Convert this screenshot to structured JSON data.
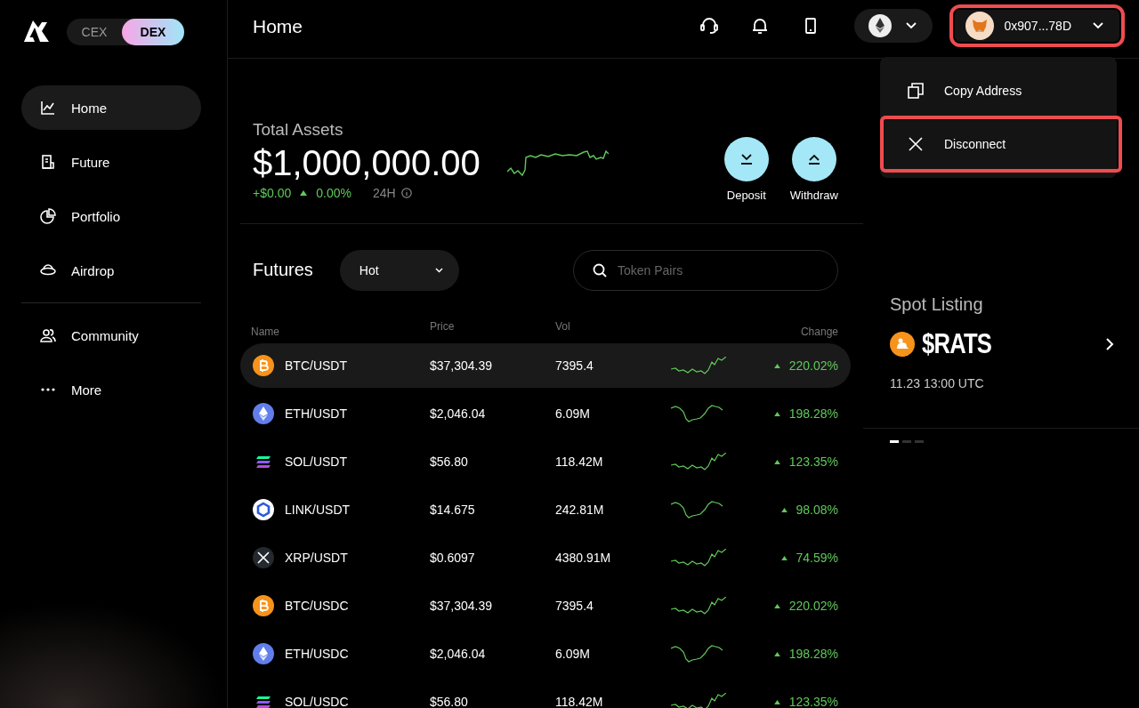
{
  "sidebar": {
    "modes": [
      {
        "label": "CEX",
        "selected": false
      },
      {
        "label": "DEX",
        "selected": true
      }
    ],
    "items": [
      {
        "label": "Home",
        "kind": "chart",
        "selected": true
      },
      {
        "label": "Future",
        "kind": "doc",
        "selected": false
      },
      {
        "label": "Portfolio",
        "kind": "pie",
        "selected": false
      },
      {
        "label": "Airdrop",
        "kind": "saucer",
        "selected": false
      },
      {
        "label": "Community",
        "kind": "people",
        "selected": false
      },
      {
        "label": "More",
        "kind": "dots",
        "selected": false
      }
    ]
  },
  "header": {
    "title": "Home",
    "wallet": {
      "address": "0x907...78D",
      "highlighted": true
    }
  },
  "wallet_menu": [
    {
      "label": "Copy Address",
      "kind": "copy",
      "highlighted": false
    },
    {
      "label": "Disconnect",
      "kind": "close",
      "highlighted": true
    }
  ],
  "assets": {
    "title": "Total Assets",
    "total": "$1,000,000.00",
    "change_amount": "+$0.00",
    "change_percent": "0.00%",
    "period": "24H",
    "actions": [
      {
        "label": "Deposit",
        "kind": "down"
      },
      {
        "label": "Withdraw",
        "kind": "up"
      }
    ]
  },
  "futures": {
    "title": "Futures",
    "filter": "Hot",
    "search": {
      "placeholder": "Token Pairs"
    },
    "columns": [
      "Name",
      "Price",
      "Vol",
      "Change"
    ],
    "rows": [
      {
        "kind": "btc",
        "name": "BTC/USDT",
        "price": "$37,304.39",
        "vol": "7395.4",
        "change": "220.02%",
        "selected": true
      },
      {
        "kind": "eth",
        "name": "ETH/USDT",
        "price": "$2,046.04",
        "vol": "6.09M",
        "change": "198.28%",
        "selected": false
      },
      {
        "kind": "sol",
        "name": "SOL/USDT",
        "price": "$56.80",
        "vol": "118.42M",
        "change": "123.35%",
        "selected": false
      },
      {
        "kind": "link",
        "name": "LINK/USDT",
        "price": "$14.675",
        "vol": "242.81M",
        "change": "98.08%",
        "selected": false
      },
      {
        "kind": "xrp",
        "name": "XRP/USDT",
        "price": "$0.6097",
        "vol": "4380.91M",
        "change": "74.59%",
        "selected": false
      },
      {
        "kind": "btc",
        "name": "BTC/USDC",
        "price": "$37,304.39",
        "vol": "7395.4",
        "change": "220.02%",
        "selected": false
      },
      {
        "kind": "eth",
        "name": "ETH/USDC",
        "price": "$2,046.04",
        "vol": "6.09M",
        "change": "198.28%",
        "selected": false
      },
      {
        "kind": "sol",
        "name": "SOL/USDC",
        "price": "$56.80",
        "vol": "118.42M",
        "change": "123.35%",
        "selected": false
      }
    ]
  },
  "spot_listing": {
    "title": "Spot Listing",
    "token": "$RATS",
    "time": "11.23 13:00 UTC",
    "pages": [
      {
        "selected": true
      },
      {
        "selected": false
      },
      {
        "selected": false
      }
    ]
  }
}
